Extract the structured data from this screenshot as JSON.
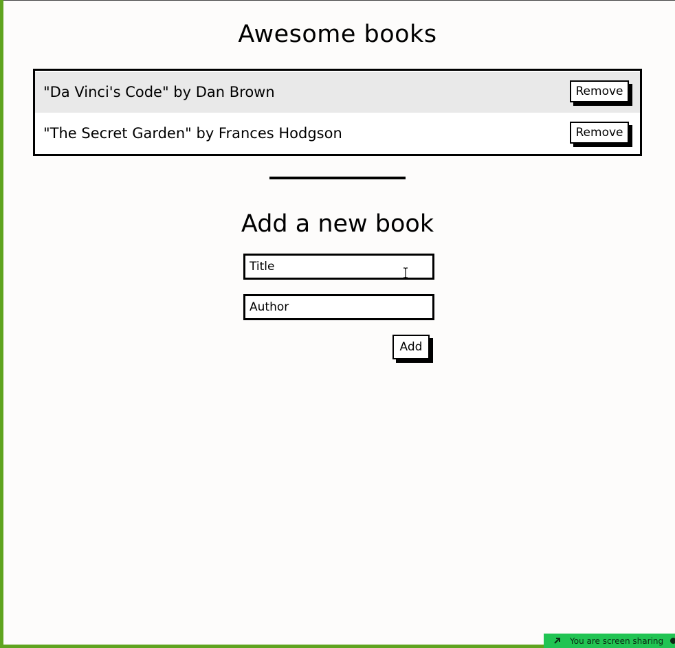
{
  "app": {
    "title": "Awesome books"
  },
  "books": [
    {
      "text": "\"Da Vinci's Code\" by Dan Brown",
      "remove_label": "Remove"
    },
    {
      "text": "\"The Secret Garden\" by Frances Hodgson",
      "remove_label": "Remove"
    }
  ],
  "form": {
    "heading": "Add a new book",
    "title_placeholder": "Title",
    "author_placeholder": "Author",
    "add_label": "Add"
  },
  "screen_share": {
    "text": "You are screen sharing"
  },
  "colors": {
    "frame_accent": "#5fa41f",
    "odd_row": "#e9e9e9",
    "share_banner": "#21c453"
  },
  "icons": {
    "text_cursor": "i-beam-cursor-icon",
    "share": "share-arrow-icon"
  }
}
